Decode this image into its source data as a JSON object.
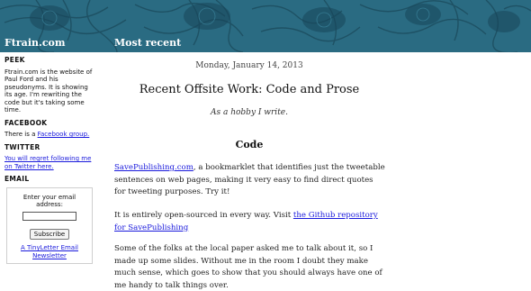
{
  "header": {
    "site_title": "Ftrain.com",
    "section_title": "Most recent",
    "banner_color": "#2a6b82"
  },
  "sidebar": {
    "peek": {
      "heading": "PEEK",
      "text": "Ftrain.com is the website of Paul Ford and his pseudonyms. It is showing its age. I'm rewriting the code but it's taking some time."
    },
    "facebook": {
      "heading": "FACEBOOK",
      "text_before": "There is a ",
      "link": "Facebook group.",
      "text_after": ""
    },
    "twitter": {
      "heading": "TWITTER",
      "link": "You will regret following me on Twitter here."
    },
    "email": {
      "heading": "EMAIL",
      "prompt": "Enter your email address:",
      "input_value": "",
      "subscribe_label": "Subscribe",
      "provider_link": "A TinyLetter Email Newsletter"
    }
  },
  "main": {
    "date": "Monday, January 14, 2013",
    "title": "Recent Offsite Work: Code and Prose",
    "subtitle": "As a hobby I write.",
    "section_heading": "Code",
    "paragraph1": {
      "link": "SavePublishing.com",
      "text": ", a bookmarklet that identifies just the tweetable sentences on web pages, making it very easy to find direct quotes for tweeting purposes. Try it!"
    },
    "paragraph2": {
      "text": "It is entirely open-sourced in every way. Visit ",
      "link": "the Github repository for SavePublishing"
    },
    "paragraph3": {
      "text": "Some of the folks at the local paper asked me to talk about it, so I made up some slides. Without me in the room I doubt they make much sense, which goes to show that you should always have one of me handy to talk things over."
    }
  }
}
